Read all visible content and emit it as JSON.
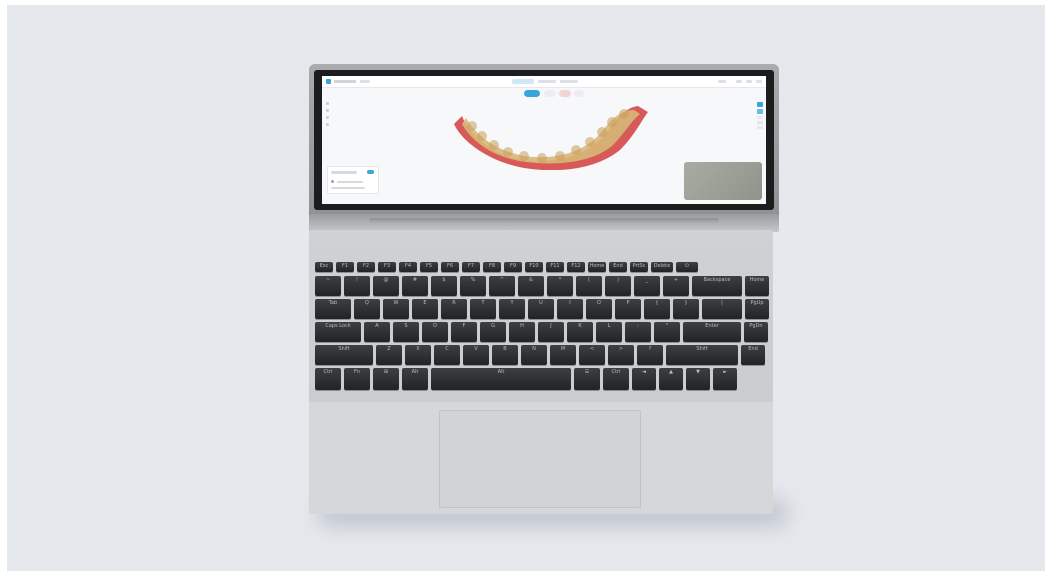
{
  "scene": {
    "background_color": "#e5e8ed",
    "laptop_body_color": "#c9cbce",
    "key_color": "#2b2c2f"
  },
  "screen_app": {
    "viewer_object": "dental-arch-3d-scan",
    "accent_color": "#3aa5d8",
    "gingiva_color": "#d85a58",
    "tooth_color": "#d7b777"
  },
  "keyboard": {
    "row1": [
      "Esc",
      "F1",
      "F2",
      "F3",
      "F4",
      "F5",
      "F6",
      "F7",
      "F8",
      "F9",
      "F10",
      "F11",
      "F12",
      "Home",
      "End",
      "PrtSc",
      "Delete",
      "⏻"
    ],
    "row2": [
      "~",
      "!",
      "@",
      "#",
      "$",
      "%",
      "^",
      "&",
      "*",
      "(",
      ")",
      "_",
      "+",
      "Backspace",
      "Home"
    ],
    "row3": [
      "Tab",
      "Q",
      "W",
      "E",
      "R",
      "T",
      "Y",
      "U",
      "I",
      "O",
      "P",
      "{",
      "}",
      "|",
      "PgUp"
    ],
    "row4": [
      "Caps Lock",
      "A",
      "S",
      "D",
      "F",
      "G",
      "H",
      "J",
      "K",
      "L",
      ":",
      "\"",
      "Enter",
      "PgDn"
    ],
    "row5": [
      "Shift",
      "Z",
      "X",
      "C",
      "V",
      "B",
      "N",
      "M",
      "<",
      ">",
      "?",
      "Shift",
      "End"
    ],
    "row6": [
      "Ctrl",
      "Fn",
      "⊞",
      "Alt",
      "Alt",
      "☰",
      "Ctrl",
      "◄",
      "▲",
      "▼",
      "►"
    ]
  }
}
